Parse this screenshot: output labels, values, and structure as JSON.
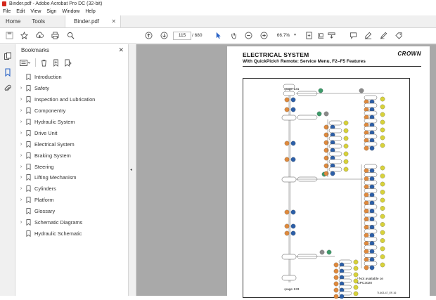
{
  "window": {
    "title": "Binder.pdf - Adobe Acrobat Pro DC (32-bit)"
  },
  "menu": [
    "File",
    "Edit",
    "View",
    "Sign",
    "Window",
    "Help"
  ],
  "tabs": {
    "home": "Home",
    "tools": "Tools",
    "document": "Binder.pdf"
  },
  "toolbar": {
    "page_current": "115",
    "page_total": "/ 680",
    "zoom": "66.7%"
  },
  "bookmarks_panel": {
    "title": "Bookmarks",
    "items": [
      {
        "label": "Introduction",
        "expandable": false
      },
      {
        "label": "Safety",
        "expandable": true
      },
      {
        "label": "Inspection and Lubrication",
        "expandable": true
      },
      {
        "label": "Componentry",
        "expandable": true
      },
      {
        "label": "Hydraulic System",
        "expandable": true
      },
      {
        "label": "Drive Unit",
        "expandable": true
      },
      {
        "label": "Electrical System",
        "expandable": true
      },
      {
        "label": "Braking System",
        "expandable": true
      },
      {
        "label": "Steering",
        "expandable": true
      },
      {
        "label": "Lifting Mechanism",
        "expandable": true
      },
      {
        "label": "Cylinders",
        "expandable": true
      },
      {
        "label": "Platform",
        "expandable": true
      },
      {
        "label": "Glossary",
        "expandable": false
      },
      {
        "label": "Schematic Diagrams",
        "expandable": true
      },
      {
        "label": "Hydraulic Schematic",
        "expandable": false
      }
    ]
  },
  "document": {
    "title": "ELECTRICAL SYSTEM",
    "subtitle": "With QuickPick® Remote: Service Menu, F2–F5 Features",
    "logo": "CROWN",
    "page_ref_top": "↓page 131",
    "page_ref_bottom": "↓page 133",
    "footnote": "¹⁾Not available on GPC3020",
    "figure_id": "TI-603-47_EF-16"
  },
  "colors": {
    "orange": "#e08a3c",
    "blue": "#2c5fa8",
    "green": "#3d9b6a",
    "yellow": "#d8d23a",
    "grey": "#8a8a8a"
  }
}
